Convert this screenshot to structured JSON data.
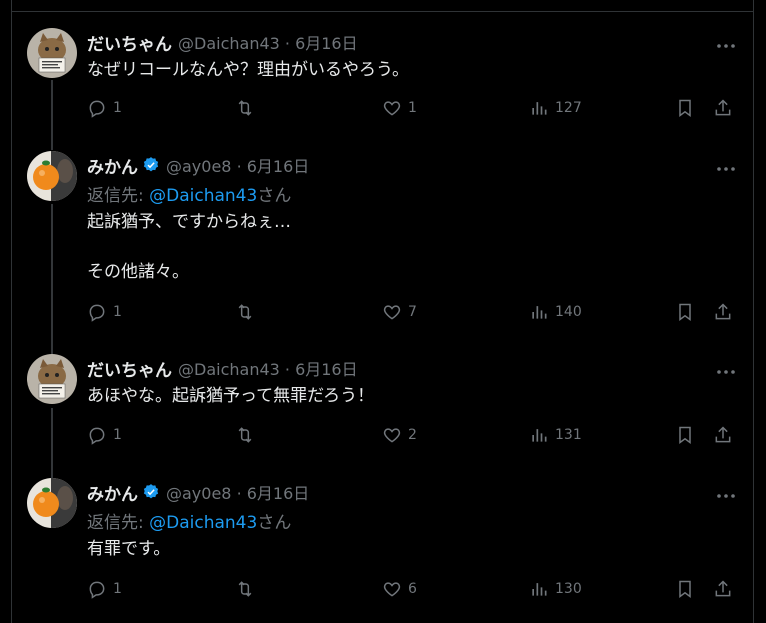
{
  "tweets": [
    {
      "name": "だいちゃん",
      "handle": "@Daichan43 · 6月16日",
      "verified": false,
      "avatar": "cat-avatar",
      "reply_prefix": "",
      "reply_mention": "",
      "reply_suffix": "",
      "text": "なぜリコールなんや？理由がいるやろう。",
      "replies": "1",
      "retweets": "",
      "likes": "1",
      "views": "127"
    },
    {
      "name": "みかん",
      "handle": "@ay0e8 · 6月16日",
      "verified": true,
      "avatar": "orange-avatar",
      "reply_prefix": "返信先: ",
      "reply_mention": "@Daichan43",
      "reply_suffix": "さん",
      "text": "起訴猶予、ですからねぇ…\n\nその他諸々。",
      "replies": "1",
      "retweets": "",
      "likes": "7",
      "views": "140"
    },
    {
      "name": "だいちゃん",
      "handle": "@Daichan43 · 6月16日",
      "verified": false,
      "avatar": "cat-avatar",
      "reply_prefix": "",
      "reply_mention": "",
      "reply_suffix": "",
      "text": "あほやな。起訴猶予って無罪だろう！",
      "replies": "1",
      "retweets": "",
      "likes": "2",
      "views": "131"
    },
    {
      "name": "みかん",
      "handle": "@ay0e8 · 6月16日",
      "verified": true,
      "avatar": "orange-avatar",
      "reply_prefix": "返信先: ",
      "reply_mention": "@Daichan43",
      "reply_suffix": "さん",
      "text": "有罪です。",
      "replies": "1",
      "retweets": "",
      "likes": "6",
      "views": "130"
    }
  ],
  "colors": {
    "background": "#000000",
    "text": "#e7e9ea",
    "muted": "#71767b",
    "accent": "#1d9bf0",
    "border": "#2f3336"
  },
  "icons": {
    "reply": "reply-icon",
    "retweet": "retweet-icon",
    "like": "heart-icon",
    "views": "views-icon",
    "bookmark": "bookmark-icon",
    "share": "share-icon",
    "more": "more-icon",
    "verified": "verified-badge-icon"
  }
}
